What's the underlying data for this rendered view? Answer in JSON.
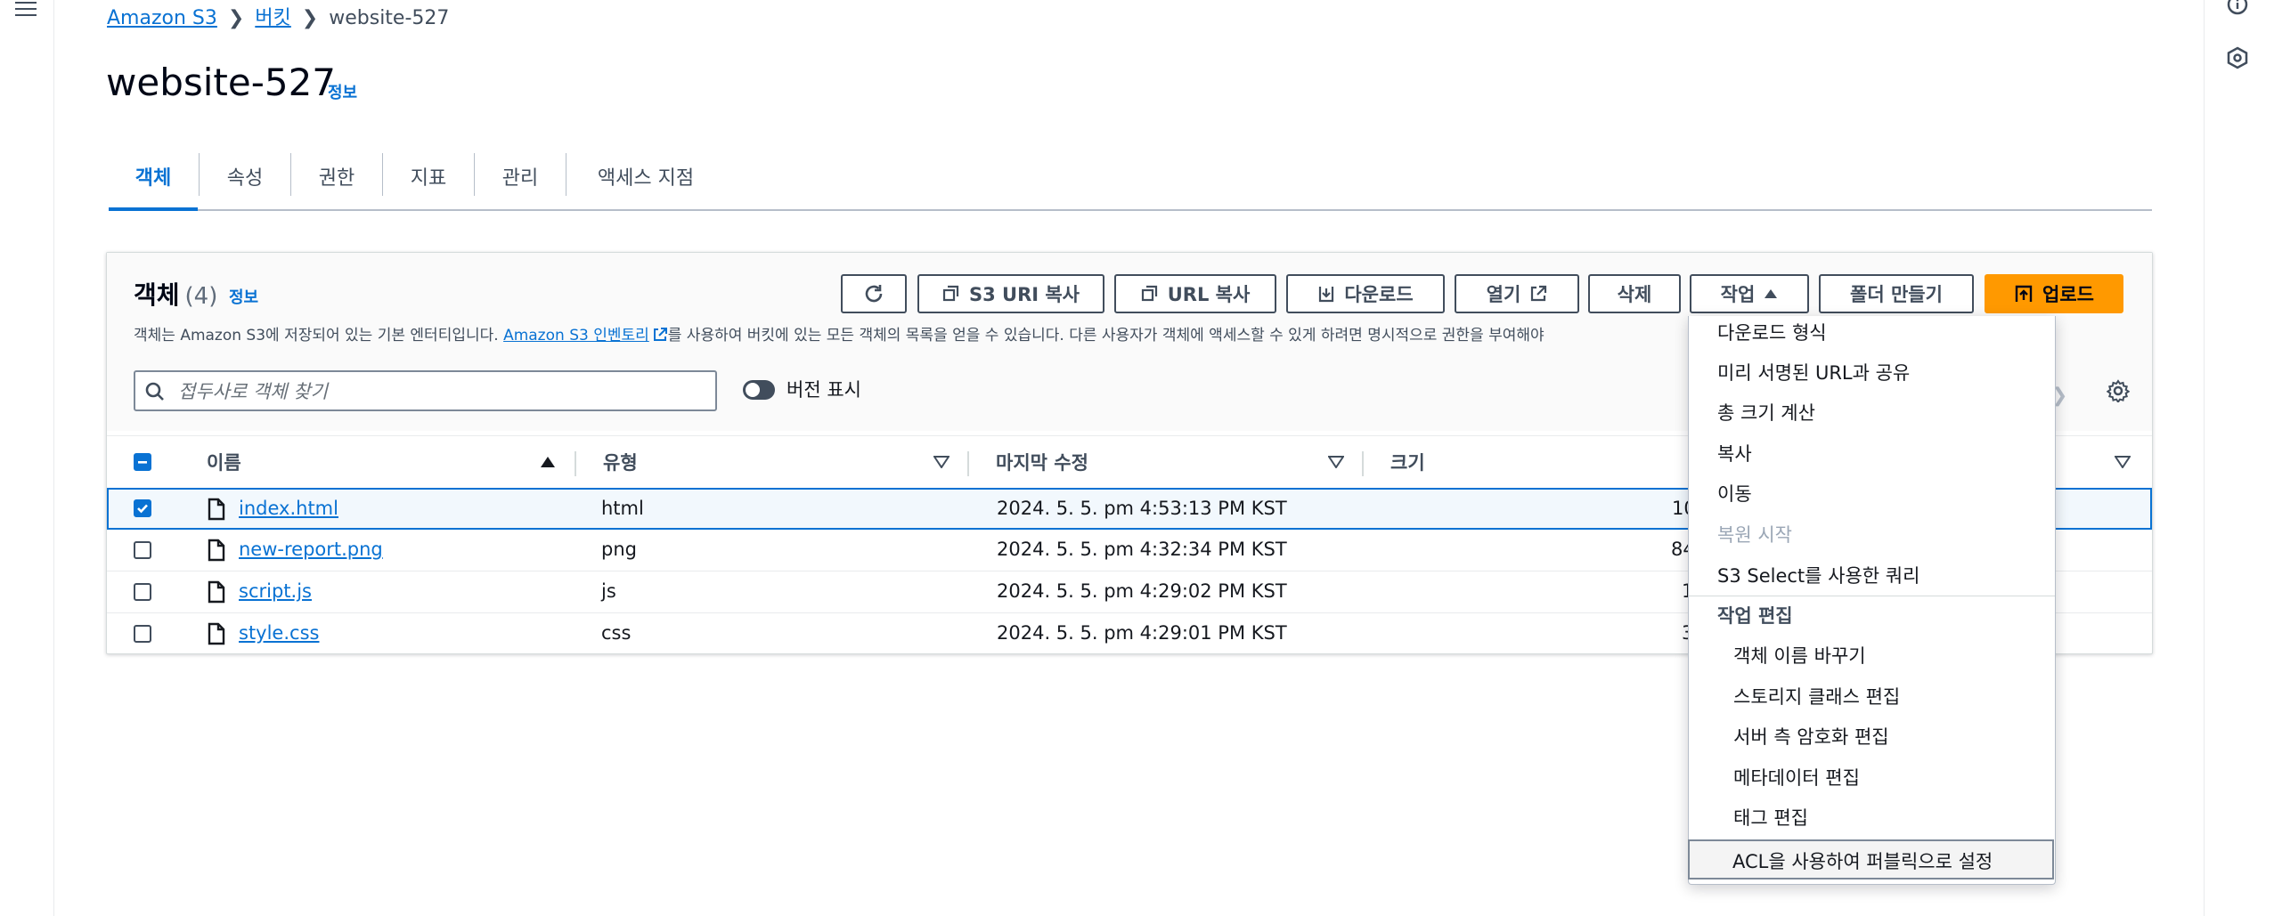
{
  "breadcrumb": {
    "root": "Amazon S3",
    "buckets": "버킷",
    "current": "website-527"
  },
  "page": {
    "title": "website-527",
    "info": "정보"
  },
  "tabs": [
    {
      "label": "객체"
    },
    {
      "label": "속성"
    },
    {
      "label": "권한"
    },
    {
      "label": "지표"
    },
    {
      "label": "관리"
    },
    {
      "label": "액세스 지점"
    }
  ],
  "objects_panel": {
    "title": "객체",
    "count": "(4)",
    "info": "정보",
    "description_prefix": "객체는 Amazon S3에 저장되어 있는 기본 엔터티입니다.",
    "inventory_link": "Amazon S3 인벤토리",
    "description_suffix": "를 사용하여 버킷에 있는 모든 객체의 목록을 얻을 수 있습니다. 다른 사용자가 객체에 액세스할 수 있게 하려면 명시적으로 권한을 부여해야",
    "buttons": {
      "copy_s3_uri": "S3 URI 복사",
      "copy_url": "URL 복사",
      "download": "다운로드",
      "open": "열기",
      "delete": "삭제",
      "actions": "작업",
      "create_folder": "폴더 만들기",
      "upload": "업로드"
    },
    "search_placeholder": "접두사로 객체 찾기",
    "version_toggle_label": "버전 표시"
  },
  "table": {
    "headers": {
      "name": "이름",
      "type": "유형",
      "last_modified": "마지막 수정",
      "size": "크기"
    },
    "rows": [
      {
        "name": "index.html",
        "type": "html",
        "modified": "2024. 5. 5. pm 4:53:13 PM KST",
        "size": "10",
        "selected": true
      },
      {
        "name": "new-report.png",
        "type": "png",
        "modified": "2024. 5. 5. pm 4:32:34 PM KST",
        "size": "84",
        "selected": false
      },
      {
        "name": "script.js",
        "type": "js",
        "modified": "2024. 5. 5. pm 4:29:02 PM KST",
        "size": "1",
        "selected": false
      },
      {
        "name": "style.css",
        "type": "css",
        "modified": "2024. 5. 5. pm 4:29:01 PM KST",
        "size": "3",
        "selected": false
      }
    ]
  },
  "actions_menu": {
    "download_as": "다운로드 형식",
    "share_presigned": "미리 서명된 URL과 공유",
    "calc_total_size": "총 크기 계산",
    "copy": "복사",
    "move": "이동",
    "initiate_restore": "복원 시작",
    "query_s3_select": "S3 Select를 사용한 쿼리",
    "edit_actions_group": "작업 편집",
    "rename_object": "객체 이름 바꾸기",
    "edit_storage_class": "스토리지 클래스 편집",
    "edit_sse": "서버 측 암호화 편집",
    "edit_metadata": "메타데이터 편집",
    "edit_tags": "태그 편집",
    "make_public_acl": "ACL을 사용하여 퍼블릭으로 설정"
  },
  "colors": {
    "link": "#0972d3",
    "primary": "#ff9900",
    "text": "#16191f",
    "border": "#414d5c"
  }
}
